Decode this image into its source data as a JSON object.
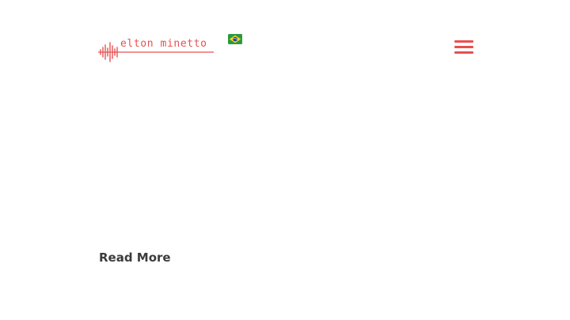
{
  "header": {
    "brand_name": "elton minetto",
    "brand_color": "#e8504f",
    "language_icon": "brazil-flag-icon",
    "menu_icon": "hamburger-menu-icon"
  },
  "main": {
    "read_more_label": "Read More",
    "text_color": "#3c3c3c"
  }
}
